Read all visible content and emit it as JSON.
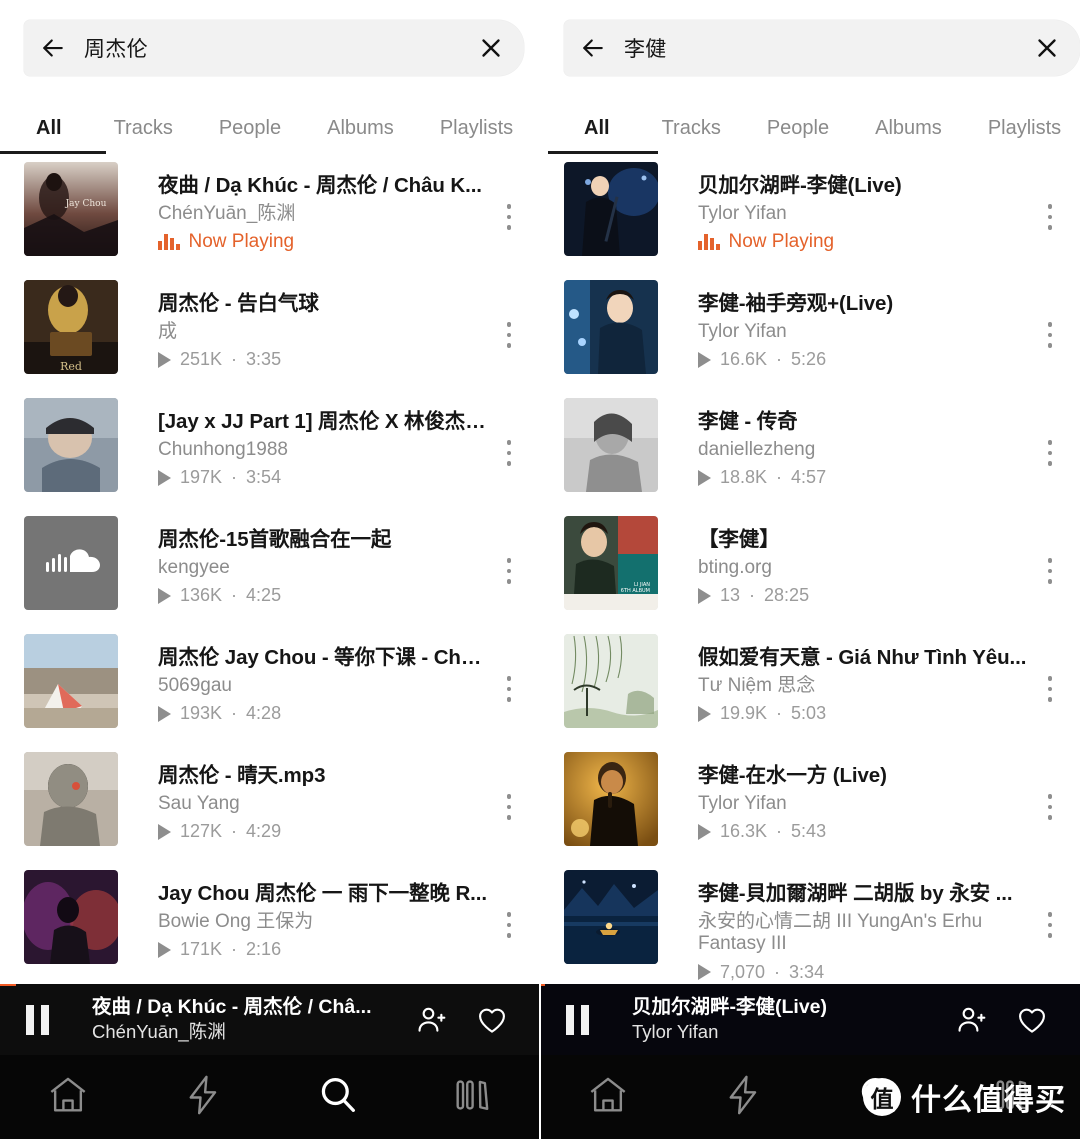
{
  "panels": [
    {
      "id": "left",
      "search": {
        "value": "周杰伦",
        "back_icon": "arrow-left-icon",
        "clear_icon": "close-icon"
      },
      "tabs": [
        {
          "label": "All",
          "active": true
        },
        {
          "label": "Tracks",
          "active": false
        },
        {
          "label": "People",
          "active": false
        },
        {
          "label": "Albums",
          "active": false
        },
        {
          "label": "Playlists",
          "active": false
        }
      ],
      "results": [
        {
          "title": "夜曲 / Dạ Khúc - 周杰伦 / Châu K...",
          "uploader": "ChénYuān_陈渊",
          "now_playing": "Now Playing",
          "plays": "",
          "duration": "",
          "art": "jay-chou-album-dark-red"
        },
        {
          "title": "周杰伦 - 告白气球",
          "uploader": "成",
          "plays": "251K",
          "duration": "3:35",
          "art": "jay-chou-gold-book"
        },
        {
          "title": "[Jay x JJ Part 1] 周杰伦 X 林俊杰 -...",
          "uploader": "Chunhong1988",
          "plays": "197K",
          "duration": "3:54",
          "art": "jay-hat-portrait"
        },
        {
          "title": "周杰伦-15首歌融合在一起",
          "uploader": "kengyee",
          "plays": "136K",
          "duration": "4:25",
          "art": "soundcloud-default-grey"
        },
        {
          "title": "周杰伦 Jay Chou - 等你下课 - Chờ...",
          "uploader": "5069gau",
          "plays": "193K",
          "duration": "4:28",
          "art": "paper-plane-beach"
        },
        {
          "title": "周杰伦 - 晴天.mp3",
          "uploader": "Sau Yang",
          "plays": "127K",
          "duration": "4:29",
          "art": "soldier-desert"
        },
        {
          "title": "Jay Chou 周杰伦 一 雨下一整晚 R...",
          "uploader": "Bowie Ong 王保为",
          "plays": "171K",
          "duration": "2:16",
          "art": "live-stage-purple"
        }
      ],
      "player": {
        "title": "夜曲 / Dạ Khúc - 周杰伦 / Châ...",
        "artist": "ChénYuān_陈渊",
        "pause_icon": "pause-icon",
        "follow_icon": "add-user-icon",
        "like_icon": "heart-icon",
        "progress_percent": 3
      },
      "nav": [
        {
          "icon": "home-icon",
          "active": false
        },
        {
          "icon": "lightning-icon",
          "active": false
        },
        {
          "icon": "search-icon",
          "active": true
        },
        {
          "icon": "library-icon",
          "active": false
        }
      ]
    },
    {
      "id": "right",
      "search": {
        "value": "李健",
        "back_icon": "arrow-left-icon",
        "clear_icon": "close-icon"
      },
      "tabs": [
        {
          "label": "All",
          "active": true
        },
        {
          "label": "Tracks",
          "active": false
        },
        {
          "label": "People",
          "active": false
        },
        {
          "label": "Albums",
          "active": false
        },
        {
          "label": "Playlists",
          "active": false
        }
      ],
      "results": [
        {
          "title": "贝加尔湖畔-李健(Live)",
          "uploader": "Tylor Yifan",
          "now_playing": "Now Playing",
          "plays": "",
          "duration": "",
          "art": "li-jian-stage-blue"
        },
        {
          "title": "李健-袖手旁观+(Live)",
          "uploader": "Tylor Yifan",
          "plays": "16.6K",
          "duration": "5:26",
          "art": "li-jian-mic-blue"
        },
        {
          "title": "李健 - 传奇",
          "uploader": "daniellezheng",
          "plays": "18.8K",
          "duration": "4:57",
          "art": "bw-woman-portrait"
        },
        {
          "title": "【李健】",
          "uploader": "bting.org",
          "plays": "13",
          "duration": "28:25",
          "art": "li-jian-6th-album"
        },
        {
          "title": "假如爱有天意 - Giá Như Tình Yêu...",
          "uploader": "Tư Niệm 思念",
          "plays": "19.9K",
          "duration": "5:03",
          "art": "willow-tree-ink"
        },
        {
          "title": "李健-在水一方 (Live)",
          "uploader": "Tylor Yifan",
          "plays": "16.3K",
          "duration": "5:43",
          "art": "li-jian-amber-stage"
        },
        {
          "title": "李健-貝加爾湖畔 二胡版 by 永安 ...",
          "uploader": "永安的心情二胡 III YungAn's Erhu Fantasy III",
          "plays": "7,070",
          "duration": "3:34",
          "art": "blue-lake-boat"
        }
      ],
      "player": {
        "title": "贝加尔湖畔-李健(Live)",
        "artist": "Tylor Yifan",
        "pause_icon": "pause-icon",
        "follow_icon": "add-user-icon",
        "like_icon": "heart-icon",
        "progress_percent": 1
      },
      "nav": [
        {
          "icon": "home-icon",
          "active": false
        },
        {
          "icon": "lightning-icon",
          "active": false
        },
        {
          "icon": "search-icon",
          "active": true
        },
        {
          "icon": "library-icon",
          "active": false
        }
      ],
      "watermark": {
        "badge": "值",
        "text": "什么值得买"
      }
    }
  ],
  "colors": {
    "accent_orange": "#e4622b",
    "player_bg": "#0d0d0d",
    "nav_bg": "#060606",
    "searchbar_bg": "#f2f2f2",
    "muted_text": "#8c8c8c"
  }
}
